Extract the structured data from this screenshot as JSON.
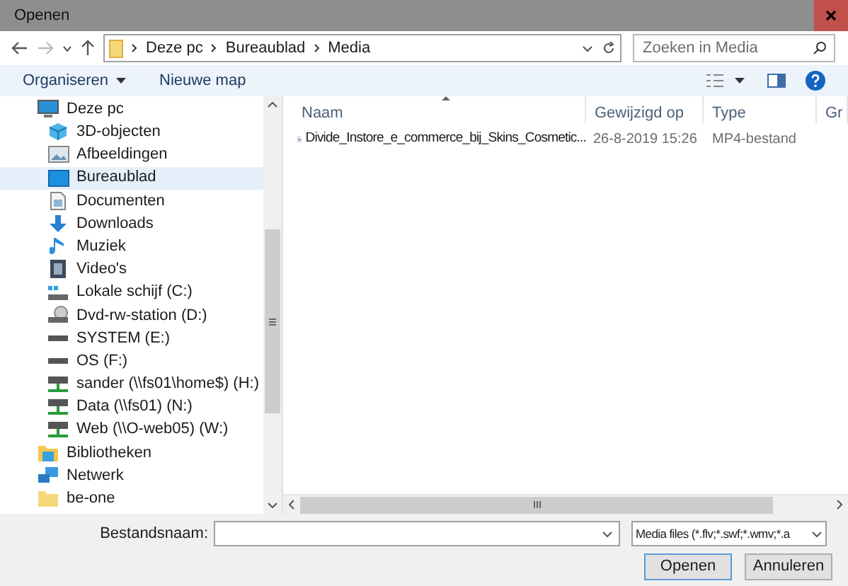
{
  "window": {
    "title": "Openen"
  },
  "address": {
    "path": [
      "Deze pc",
      "Bureaublad",
      "Media"
    ]
  },
  "search": {
    "placeholder": "Zoeken in Media"
  },
  "toolbar": {
    "organize": "Organiseren",
    "new_folder": "Nieuwe map"
  },
  "sidebar": {
    "items": [
      {
        "label": "Deze pc",
        "kind": "pc",
        "selected": false,
        "children": [
          {
            "label": "3D-objecten",
            "kind": "cube",
            "selected": false
          },
          {
            "label": "Afbeeldingen",
            "kind": "pictures",
            "selected": false
          },
          {
            "label": "Bureaublad",
            "kind": "desktop",
            "selected": true
          },
          {
            "label": "Documenten",
            "kind": "documents",
            "selected": false
          },
          {
            "label": "Downloads",
            "kind": "downloads",
            "selected": false
          },
          {
            "label": "Muziek",
            "kind": "music",
            "selected": false
          },
          {
            "label": "Video's",
            "kind": "videos",
            "selected": false
          },
          {
            "label": "Lokale schijf (C:)",
            "kind": "system-drive",
            "selected": false
          },
          {
            "label": "Dvd-rw-station (D:)",
            "kind": "dvd",
            "selected": false
          },
          {
            "label": "SYSTEM (E:)",
            "kind": "drive",
            "selected": false
          },
          {
            "label": "OS (F:)",
            "kind": "drive",
            "selected": false
          },
          {
            "label": "sander (\\\\fs01\\home$) (H:)",
            "kind": "net-drive",
            "selected": false
          },
          {
            "label": "Data (\\\\fs01) (N:)",
            "kind": "net-drive",
            "selected": false
          },
          {
            "label": "Web (\\\\O-web05) (W:)",
            "kind": "net-drive",
            "selected": false
          }
        ]
      },
      {
        "label": "Bibliotheken",
        "kind": "library",
        "selected": false
      },
      {
        "label": "Netwerk",
        "kind": "network",
        "selected": false
      },
      {
        "label": "be-one",
        "kind": "folder",
        "selected": false
      }
    ]
  },
  "table": {
    "columns": [
      "Naam",
      "Gewijzigd op",
      "Type",
      "Gr"
    ],
    "rows": [
      {
        "name": "Divide_Instore_e_commerce_bij_Skins_Cosmetic...",
        "modified": "26-8-2019 15:26",
        "type": "MP4-bestand"
      }
    ]
  },
  "filename": {
    "label": "Bestandsnaam:"
  },
  "filter": {
    "value": "Media files (*.flv;*.swf;*.wmv;*.a"
  },
  "buttons": {
    "open": "Openen",
    "cancel": "Annuleren"
  }
}
